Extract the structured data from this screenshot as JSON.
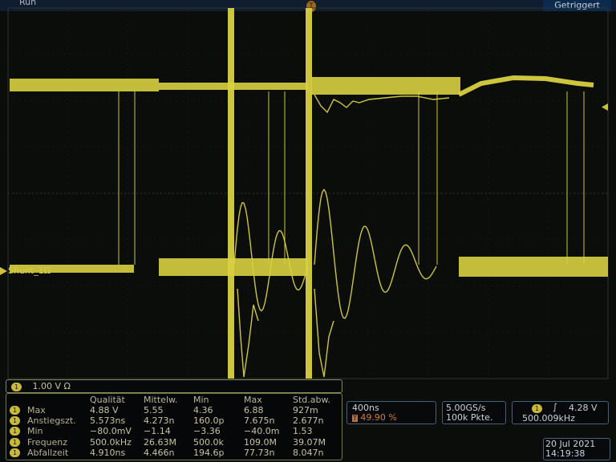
{
  "status": {
    "run_label": "Run",
    "trigger_state": "Getriggert",
    "trigger_marker": "T"
  },
  "channel": {
    "label": "Shunt_1Ω",
    "number": "1",
    "scale": "1.00 V  Ω"
  },
  "measurements": {
    "headers": [
      "Qualität",
      "Mittelw.",
      "Min",
      "Max",
      "Std.abw."
    ],
    "rows": [
      {
        "badge": "1",
        "label": "Max",
        "values": [
          "4.88 V",
          "5.55",
          "4.36",
          "6.88",
          "927m"
        ]
      },
      {
        "badge": "1",
        "label": "Anstiegszt.",
        "values": [
          "5.573ns",
          "4.273n",
          "160.0p",
          "7.675n",
          "2.677n"
        ]
      },
      {
        "badge": "1",
        "label": "Min",
        "values": [
          "−80.0mV",
          "−1.14",
          "−3.36",
          "−40.0m",
          "1.53"
        ]
      },
      {
        "badge": "1",
        "label": "Frequenz",
        "values": [
          "500.0kHz",
          "26.63M",
          "500.0k",
          "109.0M",
          "39.07M"
        ]
      },
      {
        "badge": "1",
        "label": "Abfallzeit",
        "values": [
          "4.910ns",
          "4.466n",
          "194.6p",
          "77.73n",
          "8.047n"
        ]
      }
    ]
  },
  "timebase": {
    "scale": "400ns",
    "trigger_pos_icon": "T",
    "trigger_pos": "49.90 %"
  },
  "acquisition": {
    "sample_rate": "5.00GS/s",
    "record_length": "100k Pkte."
  },
  "trigger": {
    "channel": "1",
    "edge_icon": "rising-edge-icon",
    "edge_glyph": "∫",
    "level": "4.28 V",
    "frequency": "500.009kHz"
  },
  "datetime": {
    "date": "20 Jul   2021",
    "time": "14:19:38"
  },
  "colors": {
    "trace": "#d8d040",
    "grid": "#2a2e2a",
    "background": "#0b0d0b"
  }
}
